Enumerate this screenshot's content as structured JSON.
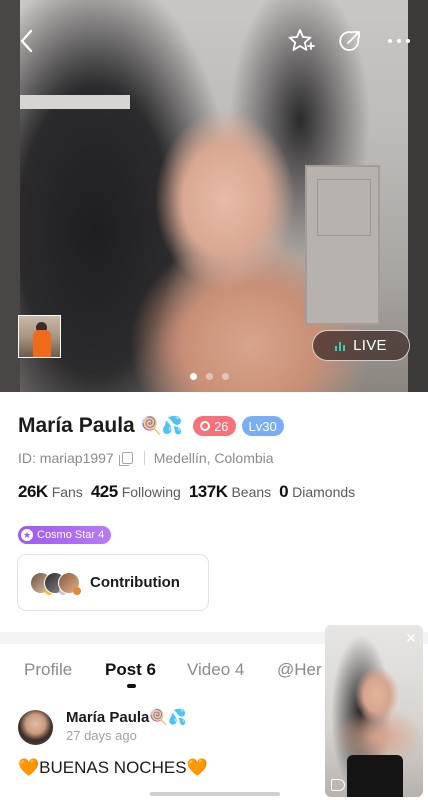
{
  "header": {
    "back_icon": "chevron-left-icon",
    "favorite_icon": "star-add-icon",
    "share_icon": "share-icon",
    "more_icon": "more-horizontal-icon"
  },
  "hero": {
    "live_label": "LIVE",
    "carousel": {
      "count": 3,
      "active": 1
    }
  },
  "profile": {
    "name": "María Paula",
    "emoji": "🍭💦",
    "fan_badge": "26",
    "level_badge": "Lv30",
    "id_text": "ID: mariap1997",
    "location": "Medellín, Colombia",
    "stats": [
      {
        "value": "26K",
        "label": "Fans"
      },
      {
        "value": "425",
        "label": "Following"
      },
      {
        "value": "137K",
        "label": "Beans"
      },
      {
        "value": "0",
        "label": "Diamonds"
      }
    ],
    "cosmo_badge": "Cosmo Star 4",
    "contribution_label": "Contribution"
  },
  "tabs": [
    {
      "label": "Profile",
      "active": false
    },
    {
      "label": "Post 6",
      "active": true
    },
    {
      "label": "Video 4",
      "active": false
    },
    {
      "label": "@Her",
      "active": false
    }
  ],
  "post": {
    "author": "María Paula",
    "author_emoji": "🍭💦",
    "time": "27 days ago",
    "text": "BUENAS NOCHES",
    "text_emoji": "🧡"
  },
  "mini_player": {
    "close_icon": "close-icon",
    "sound_icon": "sound-icon"
  },
  "colors": {
    "live_accent": "#35d0b5",
    "fan_badge": "#f7707a",
    "level_badge": "#79aef5",
    "cosmo_badge": "#9b5cf0"
  }
}
